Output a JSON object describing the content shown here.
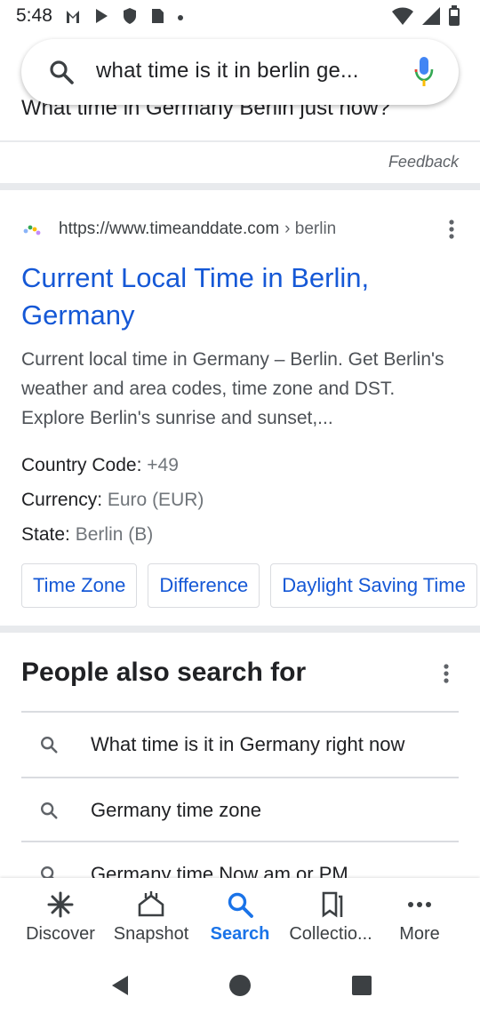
{
  "status_bar": {
    "time": "5:48"
  },
  "search": {
    "query": "what time is it in berlin ge..."
  },
  "prev_result": {
    "clipped_text": "What time in Germany Berlin just now?",
    "feedback_label": "Feedback"
  },
  "result": {
    "url": "https://www.timeanddate.com",
    "crumb": "› berlin",
    "title": "Current Local Time in Berlin, Germany",
    "snippet": "Current local time in Germany – Berlin. Get Berlin's weather and area codes, time zone and DST. Explore Berlin's sunrise and sunset,...",
    "facts": [
      {
        "key": "Country Code:",
        "value": "+49"
      },
      {
        "key": "Currency:",
        "value": "Euro (EUR)"
      },
      {
        "key": "State:",
        "value": "Berlin (B)"
      }
    ],
    "chips": [
      "Time Zone",
      "Difference",
      "Daylight Saving Time"
    ]
  },
  "people_also_search": {
    "title": "People also search for",
    "items": [
      "What time is it in Germany right now",
      "Germany time zone",
      "Germany time Now am or PM"
    ]
  },
  "bottom_nav": {
    "items": [
      {
        "label": "Discover",
        "icon": "asterisk-icon"
      },
      {
        "label": "Snapshot",
        "icon": "snapshot-icon"
      },
      {
        "label": "Search",
        "icon": "search-icon"
      },
      {
        "label": "Collectio...",
        "icon": "collections-icon"
      },
      {
        "label": "More",
        "icon": "more-horiz-icon"
      }
    ],
    "active": "Search"
  },
  "colors": {
    "link": "#1558d6",
    "active_nav": "#1a73e8",
    "mic_blue": "#4285f4",
    "mic_red": "#ea4335"
  }
}
